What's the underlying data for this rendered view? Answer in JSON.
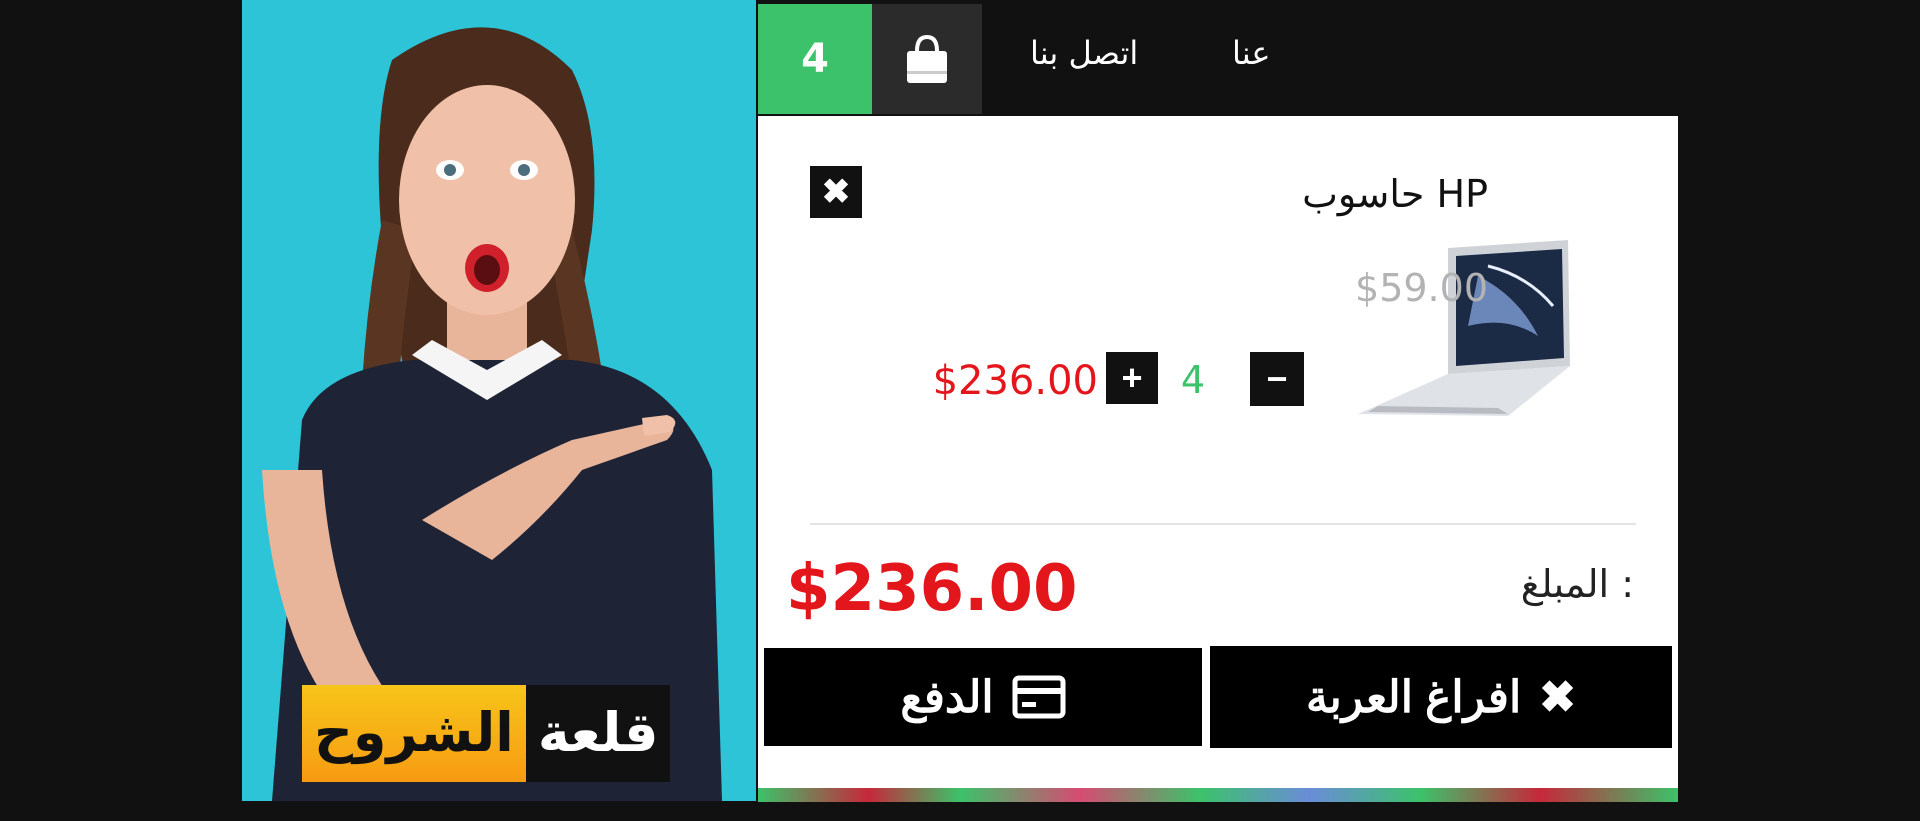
{
  "nav": {
    "cart_count": "4",
    "contact_label": "اتصل بنا",
    "about_label": "عنا"
  },
  "promo": {
    "brand_part1": "قلعة",
    "brand_part2": "الشروح"
  },
  "cart": {
    "remove_label": "✖",
    "product_name": "حاسوب HP",
    "unit_price": "$59.00",
    "quantity": "4",
    "minus_label": "−",
    "plus_label": "+",
    "line_total": "$236.00",
    "total_label": "المبلغ :",
    "total_value": "$236.00",
    "empty_label": "افراغ العربة",
    "empty_icon": "✖",
    "pay_label": "الدفع"
  },
  "colors": {
    "accent_green": "#3cc26a",
    "price_red": "#e3161b",
    "dark": "#111111",
    "promo_bg": "#2cc4d6",
    "brand_yellow": "#f7b21a"
  },
  "icons": {
    "bag": "shopping-bag-icon",
    "card": "credit-card-icon",
    "close": "close-icon"
  }
}
